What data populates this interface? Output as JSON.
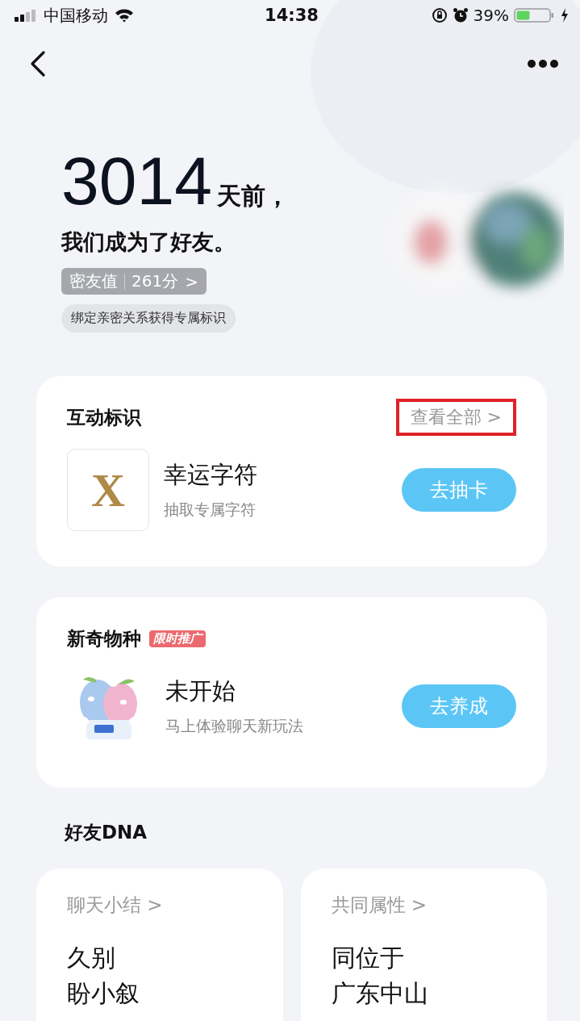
{
  "status_bar": {
    "carrier": "中国移动",
    "time": "14:38",
    "battery": "39%"
  },
  "hero": {
    "days": "3014",
    "days_suffix": "天前，",
    "subtitle": "我们成为了好友。",
    "score_label": "密友值",
    "score_value": "261分",
    "score_arrow": ">",
    "tip": "绑定亲密关系获得专属标识"
  },
  "cards": [
    {
      "title": "互动标识",
      "link": {
        "label": "查看全部 >",
        "highlighted": true
      },
      "item": {
        "kind": "letter",
        "icon_text": "X",
        "name": "幸运字符",
        "desc": "抽取专属字符",
        "button": "去抽卡"
      }
    },
    {
      "title": "新奇物种",
      "badge": "限时推广",
      "item": {
        "kind": "picture",
        "name": "未开始",
        "desc": "马上体验聊天新玩法",
        "button": "去养成"
      }
    }
  ],
  "dna": {
    "title": "好友DNA",
    "cards": [
      {
        "heading": "聊天小结 >",
        "lines": [
          "久别",
          "盼小叙"
        ]
      },
      {
        "heading": "共同属性 >",
        "lines": [
          "同位于",
          "广东中山"
        ]
      }
    ]
  }
}
